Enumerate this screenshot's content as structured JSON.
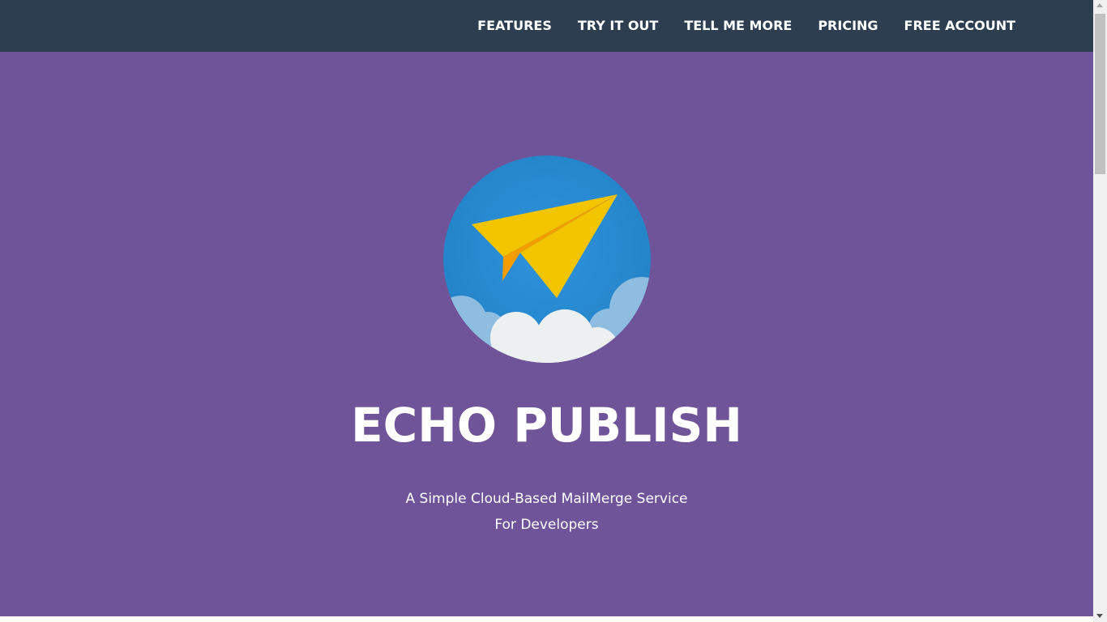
{
  "nav": {
    "items": [
      {
        "label": "FEATURES"
      },
      {
        "label": "TRY IT OUT"
      },
      {
        "label": "TELL ME MORE"
      },
      {
        "label": "PRICING"
      },
      {
        "label": "FREE ACCOUNT"
      }
    ]
  },
  "hero": {
    "logo_icon": "paper-plane-in-clouds-icon",
    "title": "ECHO PUBLISH",
    "subtitle_line1": "A Simple Cloud-Based MailMerge Service",
    "subtitle_line2": "For Developers"
  },
  "colors": {
    "navbar_bg": "#2c3e50",
    "hero_bg": "#6f5499",
    "logo_circle": "#2a8ad0",
    "plane": "#f2c500",
    "plane_shadow": "#f59d00",
    "cloud_front": "#ecf0f1",
    "cloud_back": "#8fbde0"
  }
}
